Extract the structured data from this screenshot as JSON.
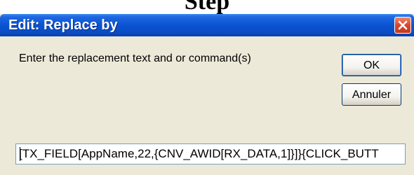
{
  "top_strip": {
    "text": "Step"
  },
  "dialog": {
    "title": "Edit: Replace by",
    "message": "Enter the replacement text and or command(s)",
    "ok_label": "OK",
    "cancel_label": "Annuler",
    "input_value": "[TX_FIELD[AppName,22,{CNV_AWID[RX_DATA,1]}]}{CLICK_BUTT"
  },
  "colors": {
    "titlebar": "#0b53d3",
    "window_bg": "#ece9d8",
    "close_button": "#d9452a"
  },
  "icons": {
    "close": "close-icon"
  }
}
